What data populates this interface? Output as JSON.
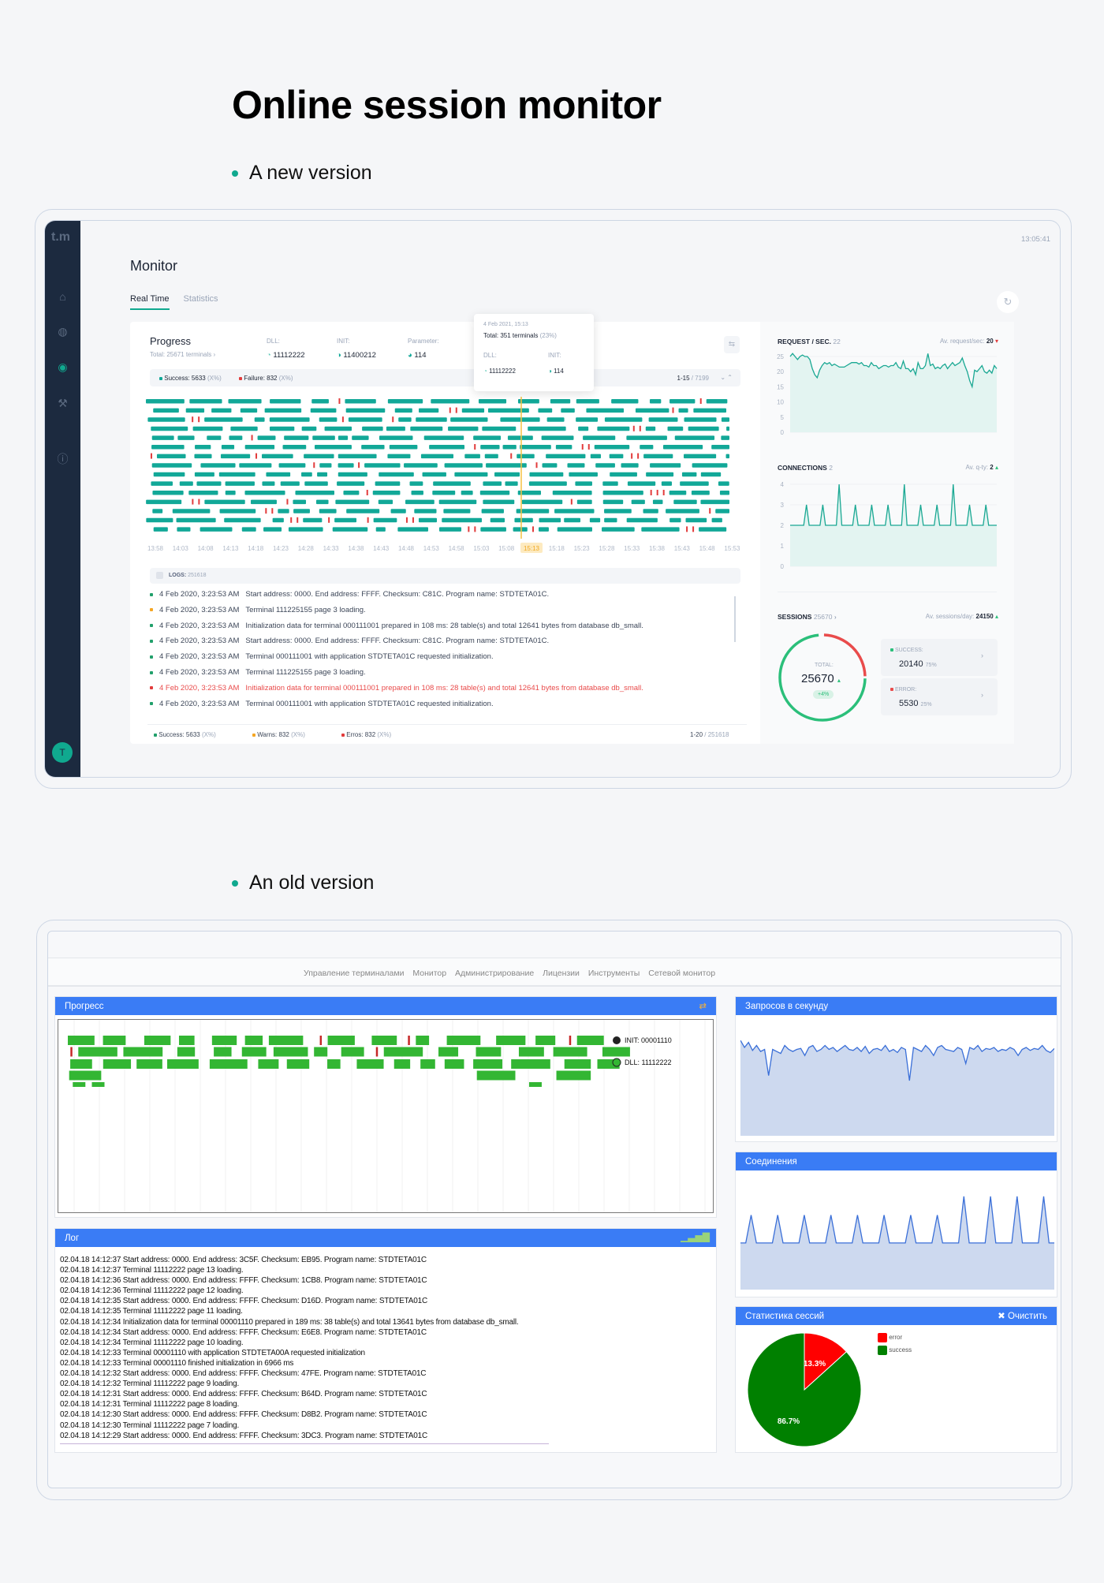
{
  "page": {
    "title": "Online session monitor",
    "new_label": "A new version",
    "old_label": "An old version"
  },
  "colors": {
    "teal": "#12a898",
    "red": "#e23c3c",
    "warn": "#f5a623",
    "green_ring": "#2bbf7a",
    "old_blue": "#3a7cf5",
    "old_green": "#33b633",
    "old_pie_green": "#008000",
    "old_pie_red": "#ff0000"
  },
  "new": {
    "logo": "t.m",
    "clock": "13:05:41",
    "title": "Monitor",
    "sidebar_icons": [
      "home-icon",
      "globe-icon",
      "monitor-icon",
      "wrench-icon",
      "info-icon"
    ],
    "avatar": "T",
    "tabs": [
      {
        "label": "Real Time",
        "active": true
      },
      {
        "label": "Statistics",
        "active": false
      }
    ],
    "progress": {
      "title": "Progress",
      "total": "Total: 25671 terminals",
      "dll_label": "DLL:",
      "dll_value": "11112222",
      "init_label": "INIT:",
      "init_value": "11400212",
      "param_label": "Parameter:",
      "param_value": "114",
      "success": "Success: 5633",
      "success_pct": "(X%)",
      "failure": "Failure: 832",
      "failure_pct": "(X%)",
      "range": "1-15",
      "range_total": "/ 7199",
      "tooltip": {
        "date": "4 Feb 2021, 15:13",
        "total": "Total: 351 terminals",
        "pct": "(23%)",
        "dll_label": "DLL:",
        "dll_value": "11112222",
        "init_label": "INIT:",
        "init_value": "114"
      },
      "ticks": [
        "13:58",
        "14:03",
        "14:08",
        "14:13",
        "14:18",
        "14:23",
        "14:28",
        "14:33",
        "14:38",
        "14:43",
        "14:48",
        "14:53",
        "14:58",
        "15:03",
        "15:08",
        "15:13",
        "15:18",
        "15:23",
        "15:28",
        "15:33",
        "15:38",
        "15:43",
        "15:48",
        "15:53"
      ],
      "selected_tick": "15:13"
    },
    "logs": {
      "label": "LOGS:",
      "count": "251618",
      "rows": [
        {
          "level": "success",
          "time": "4 Feb 2020, 3:23:53 AM",
          "text": "Start address: 0000.  End address: FFFF.  Checksum: C81C.  Program name: STDTETA01C."
        },
        {
          "level": "warn",
          "time": "4 Feb 2020, 3:23:53 AM",
          "text": "Terminal 111225155 page 3 loading."
        },
        {
          "level": "success",
          "time": "4 Feb 2020, 3:23:53 AM",
          "text": "Initialization data for terminal 000111001 prepared in 108 ms: 28 table(s) and total 12641 bytes from database db_small."
        },
        {
          "level": "success",
          "time": "4 Feb 2020, 3:23:53 AM",
          "text": "Start address: 0000.  End address: FFFF.  Checksum: C81C.  Program name: STDTETA01C."
        },
        {
          "level": "success",
          "time": "4 Feb 2020, 3:23:53 AM",
          "text": "Terminal 000111001 with application STDTETA01C requested initialization."
        },
        {
          "level": "success",
          "time": "4 Feb 2020, 3:23:53 AM",
          "text": "Terminal 111225155 page 3 loading."
        },
        {
          "level": "error",
          "time": "4 Feb 2020, 3:23:53 AM",
          "text": "Initialization data for terminal 000111001 prepared in 108 ms: 28 table(s) and total 12641 bytes from database db_small."
        },
        {
          "level": "success",
          "time": "4 Feb 2020, 3:23:53 AM",
          "text": "Terminal 000111001 with application STDTETA01C requested initialization."
        }
      ],
      "footer": {
        "success": "Success: 5633",
        "warns": "Warns: 832",
        "errors": "Erros: 832",
        "pct": "(X%)",
        "range": "1-20",
        "total": "/ 251618"
      }
    },
    "requests": {
      "title": "REQUEST / SEC.",
      "current": "22",
      "avg_label": "Av. request/sec:",
      "avg": "20",
      "trend": "down"
    },
    "connections": {
      "title": "CONNECTIONS",
      "current": "2",
      "avg_label": "Av. q-ty:",
      "avg": "2",
      "trend": "up"
    },
    "sessions": {
      "title": "SESSIONS",
      "count": "25670",
      "avg_label": "Av. sessions/day:",
      "avg": "24150",
      "trend": "up",
      "total_label": "TOTAL:",
      "total": "25670",
      "change": "+4%",
      "success_label": "SUCCESS:",
      "success": "20140",
      "success_pct": "75%",
      "error_label": "ERROR:",
      "error": "5530",
      "error_pct": "25%"
    }
  },
  "old": {
    "nav": [
      "Управление терминалами",
      "Монитор",
      "Администрирование",
      "Лицензии",
      "Инструменты",
      "Сетевой монитор"
    ],
    "progress_title": "Прогресс",
    "init_label": "INIT: 00001110",
    "dll_label": "DLL: 11112222",
    "log_title": "Лог",
    "log": [
      "02.04.18 14:12:37 Start address: 0000. End address: 3C5F. Checksum: EB95. Program name: STDTETA01C",
      "02.04.18 14:12:37 Terminal 11112222 page 13 loading.",
      "02.04.18 14:12:36 Start address: 0000. End address: FFFF. Checksum: 1CB8. Program name: STDTETA01C",
      "02.04.18 14:12:36 Terminal 11112222 page 12 loading.",
      "02.04.18 14:12:35 Start address: 0000. End address: FFFF. Checksum: D16D. Program name: STDTETA01C",
      "02.04.18 14:12:35 Terminal 11112222 page 11 loading.",
      "02.04.18 14:12:34 Initialization data for terminal 00001110 prepared in 189 ms: 38 table(s) and total 13641 bytes from database db_small.",
      "02.04.18 14:12:34 Start address: 0000. End address: FFFF. Checksum: E6E8. Program name: STDTETA01C",
      "02.04.18 14:12:34 Terminal 11112222 page 10 loading.",
      "02.04.18 14:12:33 Terminal 00001110 with application STDTETA00A requested initialization",
      "02.04.18 14:12:33 Terminal 00001110 finished initialization in 6966 ms",
      "02.04.18 14:12:32 Start address: 0000. End address: FFFF. Checksum: 47FE. Program name: STDTETA01C",
      "02.04.18 14:12:32 Terminal 11112222 page 9 loading.",
      "02.04.18 14:12:31 Start address: 0000. End address: FFFF. Checksum: B64D. Program name: STDTETA01C",
      "02.04.18 14:12:31 Terminal 11112222 page 8 loading.",
      "02.04.18 14:12:30 Start address: 0000. End address: FFFF. Checksum: D8B2. Program name: STDTETA01C",
      "02.04.18 14:12:30 Terminal 11112222 page 7 loading.",
      "02.04.18 14:12:29 Start address: 0000. End address: FFFF. Checksum: 3DC3. Program name: STDTETA01C"
    ],
    "requests_title": "Запросов в секунду",
    "connections_title": "Соединения",
    "sessions_title": "Статистика сессий",
    "clear_label": "Очистить",
    "legend": [
      "error",
      "success"
    ]
  },
  "chart_data": [
    {
      "type": "line",
      "title": "REQUEST / SEC.",
      "ylim": [
        0,
        25
      ],
      "yticks": [
        0,
        5,
        10,
        15,
        20,
        25
      ],
      "grid": true,
      "fill": "area",
      "values": [
        25,
        26,
        25,
        24,
        25,
        25.5,
        25,
        25,
        24,
        21,
        19,
        18,
        20.5,
        22,
        23,
        22.5,
        23,
        22,
        22.5,
        22,
        21.5,
        21.5,
        21.5,
        22,
        22.5,
        23,
        23,
        23,
        22.5,
        23,
        22,
        22,
        21.5,
        23,
        22,
        22,
        21,
        21.5,
        22,
        22,
        21.5,
        22,
        22,
        23,
        21.5,
        21,
        23.5,
        21,
        21,
        20,
        21,
        19,
        23,
        21,
        21,
        22,
        26,
        22,
        22.5,
        21,
        21.5,
        21,
        22,
        22.5,
        21,
        22,
        23,
        22,
        22.5,
        23,
        24.5,
        22,
        20,
        17,
        15,
        20.5,
        20,
        21,
        22,
        20,
        19.5,
        20.5,
        19.5,
        22,
        21
      ]
    },
    {
      "type": "line",
      "title": "CONNECTIONS",
      "ylim": [
        0,
        4
      ],
      "yticks": [
        0,
        1,
        2,
        3,
        4
      ],
      "grid": true,
      "fill": "area",
      "values": [
        2,
        2,
        2,
        2,
        2,
        2,
        3,
        2,
        2,
        2,
        2,
        2,
        3,
        2,
        2,
        2,
        2,
        2,
        4,
        2,
        2,
        2,
        2,
        2,
        3,
        2,
        2,
        2,
        2,
        2,
        3,
        2,
        2,
        2,
        2,
        2,
        3,
        2,
        2,
        2,
        2,
        2,
        4,
        2,
        2,
        2,
        2,
        2,
        3,
        2,
        2,
        2,
        2,
        2,
        3,
        2,
        2,
        2,
        2,
        2,
        4,
        2,
        2,
        2,
        2,
        2,
        3,
        2,
        2,
        2,
        2,
        2,
        3,
        2,
        2,
        2,
        2
      ]
    },
    {
      "type": "pie",
      "title": "SESSIONS",
      "labels": [
        "success",
        "error"
      ],
      "values": [
        20140,
        5530
      ],
      "percent": [
        75,
        25
      ]
    },
    {
      "type": "line",
      "title": "Запросов в секунду",
      "values": [
        0.95,
        0.88,
        0.93,
        0.85,
        0.9,
        0.84,
        0.86,
        0.6,
        0.86,
        0.84,
        0.82,
        0.9,
        0.86,
        0.84,
        0.86,
        0.87,
        0.8,
        0.88,
        0.9,
        0.84,
        0.86,
        0.9,
        0.86,
        0.88,
        0.84,
        0.87,
        0.9,
        0.86,
        0.85,
        0.88,
        0.84,
        0.89,
        0.82,
        0.86,
        0.87,
        0.85,
        0.9,
        0.84,
        0.86,
        0.83,
        0.88,
        0.86,
        0.55,
        0.88,
        0.86,
        0.84,
        0.9,
        0.86,
        0.8,
        0.88,
        0.9,
        0.86,
        0.85,
        0.84,
        0.88,
        0.86,
        0.72,
        0.88,
        0.86,
        0.9,
        0.84,
        0.87,
        0.86,
        0.88,
        0.84,
        0.86,
        0.85,
        0.88,
        0.86,
        0.8,
        0.86,
        0.88,
        0.85,
        0.87,
        0.86,
        0.9,
        0.85,
        0.83,
        0.87
      ]
    },
    {
      "type": "line",
      "title": "Соединения",
      "values": [
        0.5,
        0.5,
        0.8,
        0.5,
        0.5,
        0.5,
        0.5,
        0.8,
        0.5,
        0.5,
        0.5,
        0.5,
        0.8,
        0.5,
        0.5,
        0.5,
        0.5,
        0.8,
        0.5,
        0.5,
        0.5,
        0.5,
        0.8,
        0.5,
        0.5,
        0.5,
        0.5,
        0.8,
        0.5,
        0.5,
        0.5,
        0.5,
        0.8,
        0.5,
        0.5,
        0.5,
        0.5,
        0.8,
        0.5,
        0.5,
        0.5,
        0.5,
        1.0,
        0.5,
        0.5,
        0.5,
        0.5,
        1.0,
        0.5,
        0.5,
        0.5,
        0.5,
        1.0,
        0.5,
        0.5,
        0.5,
        0.5,
        1.0,
        0.5,
        0.5
      ]
    },
    {
      "type": "pie",
      "title": "Статистика сессий",
      "labels": [
        "error",
        "success"
      ],
      "percent": [
        13.3,
        86.7
      ]
    }
  ]
}
